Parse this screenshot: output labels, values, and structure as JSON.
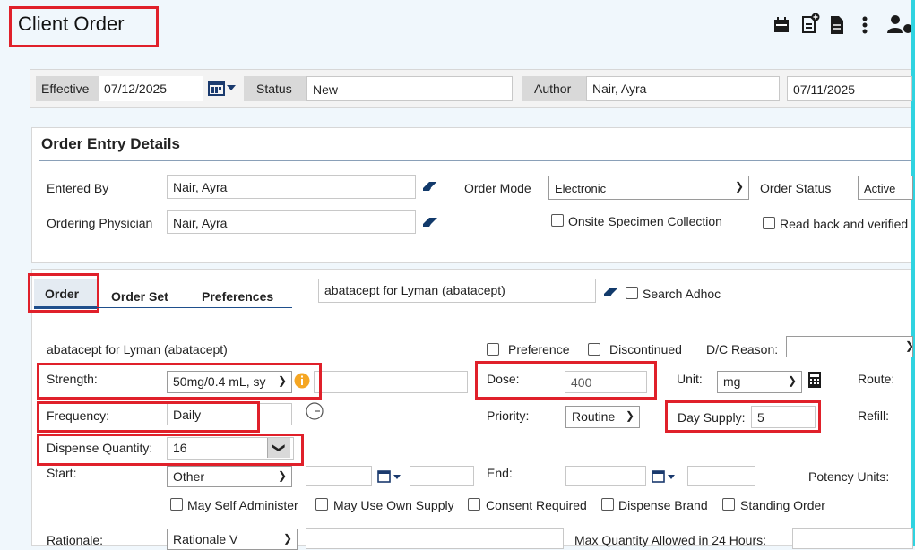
{
  "header": {
    "title": "Client Order"
  },
  "topbar": {
    "effective_label": "Effective",
    "effective_value": "07/12/2025",
    "status_label": "Status",
    "status_value": "New",
    "author_label": "Author",
    "author_value": "Nair, Ayra",
    "author_date": "07/11/2025"
  },
  "entry": {
    "section_title": "Order Entry Details",
    "entered_by_label": "Entered By",
    "entered_by_value": "Nair, Ayra",
    "ordering_physician_label": "Ordering Physician",
    "ordering_physician_value": "Nair, Ayra",
    "order_mode_label": "Order Mode",
    "order_mode_value": "Electronic",
    "order_status_label": "Order Status",
    "order_status_value": "Active",
    "onsite_specimen_label": "Onsite Specimen Collection",
    "read_back_label": "Read back and verified"
  },
  "tabs": {
    "order": "Order",
    "order_set": "Order Set",
    "preferences": "Preferences"
  },
  "search": {
    "value": "abatacept for Lyman (abatacept)",
    "adhoc_label": "Search Adhoc"
  },
  "order": {
    "med_name": "abatacept for Lyman (abatacept)",
    "preference_label": "Preference",
    "discontinued_label": "Discontinued",
    "dc_reason_label": "D/C Reason:",
    "strength_label": "Strength:",
    "strength_value": "50mg/0.4 mL, sy",
    "dose_label": "Dose:",
    "dose_value": "400",
    "unit_label": "Unit:",
    "unit_value": "mg",
    "route_label": "Route:",
    "frequency_label": "Frequency:",
    "frequency_value": "Daily",
    "priority_label": "Priority:",
    "priority_value": "Routine",
    "day_supply_label": "Day Supply:",
    "day_supply_value": "5",
    "refill_label": "Refill:",
    "dispense_qty_label": "Dispense Quantity:",
    "dispense_qty_value": "16",
    "start_label": "Start:",
    "start_value": "Other",
    "end_label": "End:",
    "potency_label": "Potency Units:",
    "may_self_label": "May Self Administer",
    "may_own_label": "May Use Own Supply",
    "consent_label": "Consent Required",
    "dispense_brand_label": "Dispense Brand",
    "standing_label": "Standing Order",
    "rationale_label": "Rationale:",
    "rationale_value": "Rationale V",
    "max_qty_label": "Max Quantity Allowed in 24 Hours:"
  }
}
